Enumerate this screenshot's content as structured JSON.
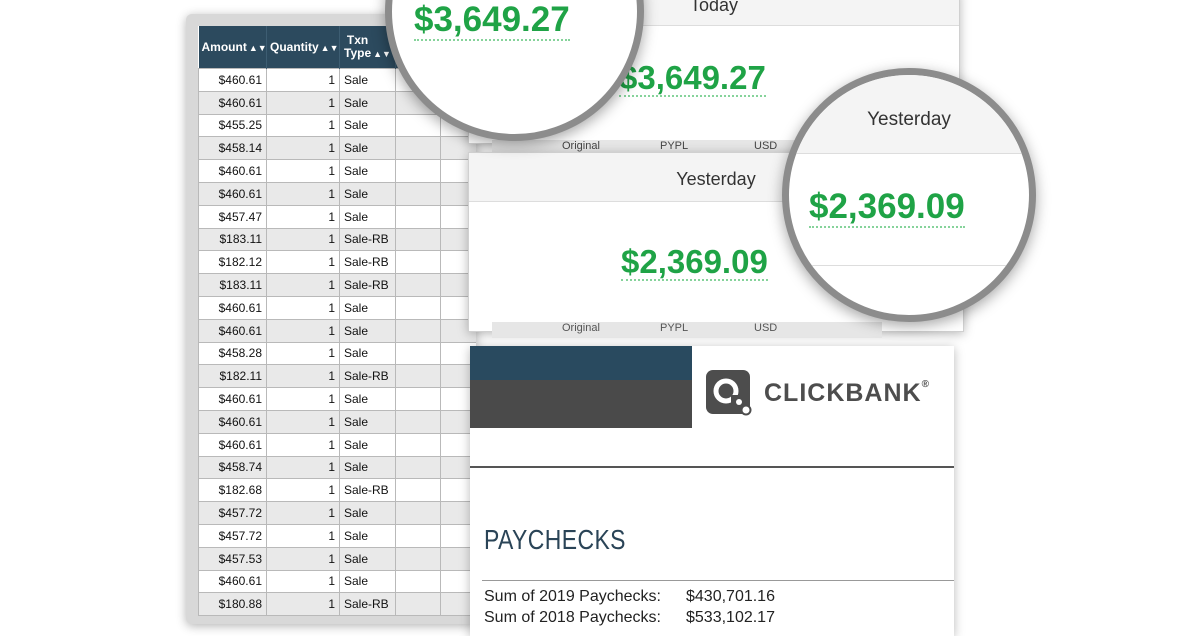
{
  "table": {
    "headers": [
      {
        "label": "Amount",
        "sort": "▲▼"
      },
      {
        "label": "Quantity",
        "sort": "▲▼"
      },
      {
        "label": "Txn\nType",
        "sort": "▲▼"
      }
    ],
    "rows": [
      {
        "amount": "$460.61",
        "quantity": "1",
        "type": "Sale"
      },
      {
        "amount": "$460.61",
        "quantity": "1",
        "type": "Sale"
      },
      {
        "amount": "$455.25",
        "quantity": "1",
        "type": "Sale"
      },
      {
        "amount": "$458.14",
        "quantity": "1",
        "type": "Sale"
      },
      {
        "amount": "$460.61",
        "quantity": "1",
        "type": "Sale"
      },
      {
        "amount": "$460.61",
        "quantity": "1",
        "type": "Sale"
      },
      {
        "amount": "$457.47",
        "quantity": "1",
        "type": "Sale"
      },
      {
        "amount": "$183.11",
        "quantity": "1",
        "type": "Sale-RB"
      },
      {
        "amount": "$182.12",
        "quantity": "1",
        "type": "Sale-RB"
      },
      {
        "amount": "$183.11",
        "quantity": "1",
        "type": "Sale-RB"
      },
      {
        "amount": "$460.61",
        "quantity": "1",
        "type": "Sale"
      },
      {
        "amount": "$460.61",
        "quantity": "1",
        "type": "Sale"
      },
      {
        "amount": "$458.28",
        "quantity": "1",
        "type": "Sale"
      },
      {
        "amount": "$182.11",
        "quantity": "1",
        "type": "Sale-RB"
      },
      {
        "amount": "$460.61",
        "quantity": "1",
        "type": "Sale"
      },
      {
        "amount": "$460.61",
        "quantity": "1",
        "type": "Sale"
      },
      {
        "amount": "$460.61",
        "quantity": "1",
        "type": "Sale"
      },
      {
        "amount": "$458.74",
        "quantity": "1",
        "type": "Sale"
      },
      {
        "amount": "$182.68",
        "quantity": "1",
        "type": "Sale-RB"
      },
      {
        "amount": "$457.72",
        "quantity": "1",
        "type": "Sale"
      },
      {
        "amount": "$457.72",
        "quantity": "1",
        "type": "Sale"
      },
      {
        "amount": "$457.53",
        "quantity": "1",
        "type": "Sale"
      },
      {
        "amount": "$460.61",
        "quantity": "1",
        "type": "Sale"
      },
      {
        "amount": "$180.88",
        "quantity": "1",
        "type": "Sale-RB"
      }
    ]
  },
  "today": {
    "label": "Today",
    "amount": "$3,649.27"
  },
  "yesterday": {
    "label": "Yesterday",
    "amount": "$2,369.09"
  },
  "strips": {
    "row1": [
      "Original",
      "PYPL",
      "USD"
    ],
    "row2": [
      "Original",
      "PYPL",
      "USD"
    ]
  },
  "clickbank": {
    "logo_text": "CLICKBANK",
    "logo_mark": "®",
    "title": "PAYCHECKS",
    "sums": [
      {
        "label": "Sum of 2019 Paychecks:",
        "value": "$430,701.16"
      },
      {
        "label": "Sum of 2018 Paychecks:",
        "value": "$533,102.17"
      }
    ]
  },
  "colors": {
    "money_green": "#1fa346",
    "header_navy": "#2c4a5e",
    "brand_dark": "#4a4a4a"
  },
  "icons": {
    "sort": "sort-arrows-icon",
    "logo": "clickbank-logo-icon"
  }
}
